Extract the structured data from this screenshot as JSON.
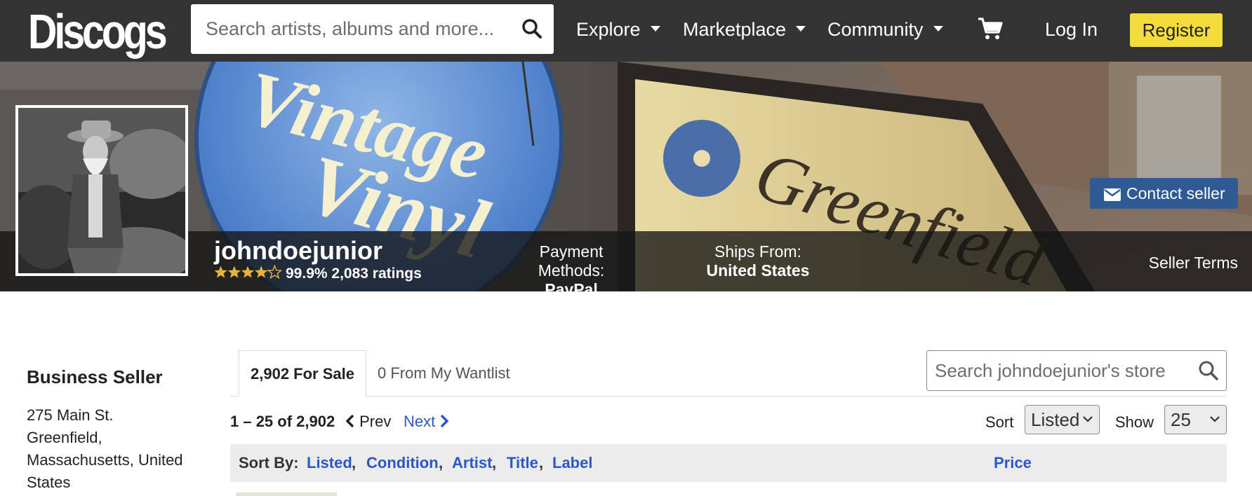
{
  "nav": {
    "logo": "Discogs",
    "search_placeholder": "Search artists, albums and more...",
    "items": [
      {
        "label": "Explore"
      },
      {
        "label": "Marketplace"
      },
      {
        "label": "Community"
      }
    ],
    "cart_icon": "cart-icon",
    "login": "Log In",
    "register": "Register",
    "colors": {
      "bar": "#333333",
      "register_bg": "#f4dc3c"
    }
  },
  "hero": {
    "banner_sign_text": [
      "Vintage",
      "Vinyl",
      "Greenfield"
    ],
    "seller_name": "johndoejunior",
    "rating_stars": 4.5,
    "rating_percent": "99.9%",
    "rating_count": "2,083 ratings",
    "payment_label": "Payment Methods:",
    "payment_value": "PayPal",
    "ships_label": "Ships From:",
    "ships_value": "United States",
    "seller_terms": "Seller Terms",
    "contact_seller": "Contact seller",
    "contact_icon": "envelope-icon",
    "colors": {
      "contact_bg": "#2f5a93"
    }
  },
  "sidebar": {
    "title": "Business Seller",
    "address_lines": [
      "275 Main St.",
      "Greenfield,",
      "Massachusetts, United",
      "States"
    ]
  },
  "tabs": [
    {
      "label": "2,902 For Sale",
      "active": true
    },
    {
      "label": "0 From My Wantlist",
      "active": false
    }
  ],
  "store_search": {
    "placeholder": "Search johndoejunior's store"
  },
  "pagination": {
    "range": "1 – 25 of 2,902",
    "prev": "Prev",
    "next": "Next",
    "sort_label": "Sort",
    "sort_value": "Listed",
    "show_label": "Show",
    "show_value": "25"
  },
  "sortbar": {
    "label": "Sort By:",
    "links": [
      "Listed",
      "Condition",
      "Artist",
      "Title",
      "Label"
    ],
    "price": "Price",
    "colors": {
      "link": "#2d56c8",
      "bg": "#ececec"
    }
  }
}
